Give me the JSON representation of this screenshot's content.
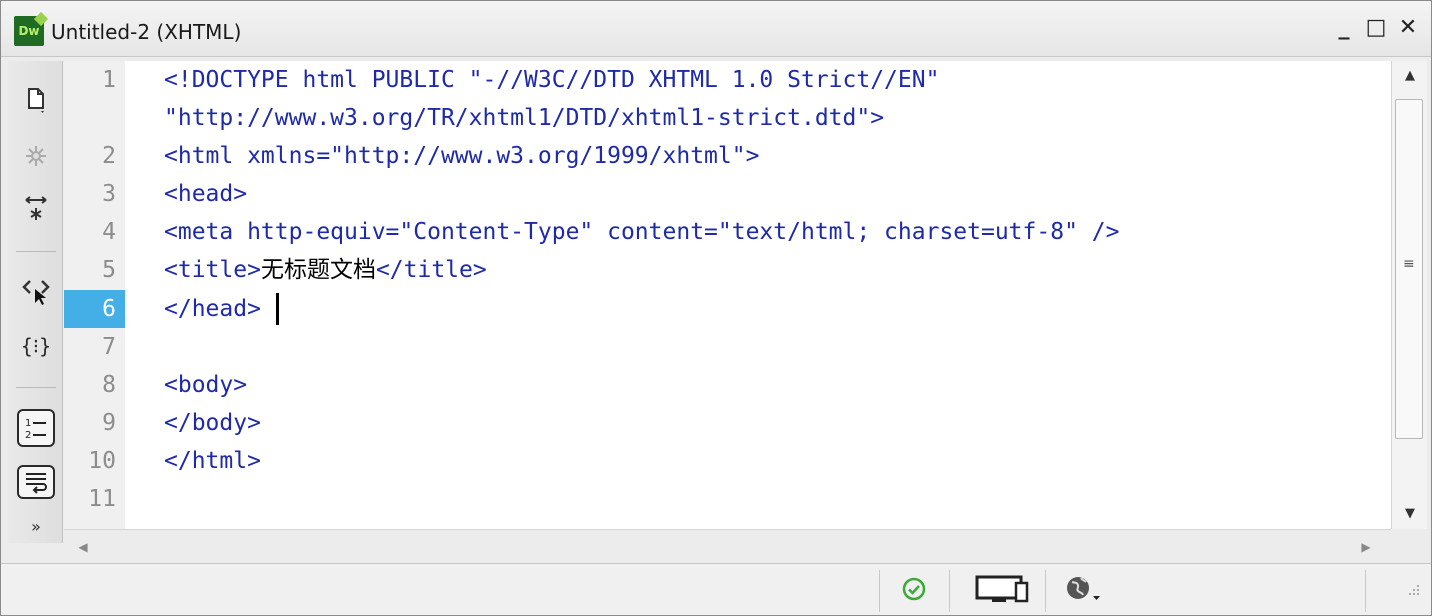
{
  "window": {
    "title": "Untitled-2 (XHTML)",
    "app_logo": "Dw",
    "controls": {
      "minimize": "_",
      "maximize": "□",
      "close": "✕"
    }
  },
  "toolbar": {
    "items": [
      {
        "icon": "open-documents-icon"
      },
      {
        "icon": "show-code-navigator-icon"
      },
      {
        "icon": "expand-selection-icon"
      },
      {
        "icon": "select-parent-tag-icon"
      },
      {
        "icon": "balance-braces-icon"
      },
      {
        "icon": "line-numbers-icon"
      },
      {
        "icon": "word-wrap-icon"
      },
      {
        "icon": "more-tools-icon"
      }
    ]
  },
  "editor": {
    "active_line": 6,
    "line_numbers": [
      "1",
      "",
      "2",
      "3",
      "4",
      "5",
      "6",
      "7",
      "8",
      "9",
      "10",
      "11"
    ],
    "lines": [
      "<!DOCTYPE html PUBLIC \"-//W3C//DTD XHTML 1.0 Strict//EN\"",
      "\"http://www.w3.org/TR/xhtml1/DTD/xhtml1-strict.dtd\">",
      "<html xmlns=\"http://www.w3.org/1999/xhtml\">",
      "<head>",
      "<meta http-equiv=\"Content-Type\" content=\"text/html; charset=utf-8\" />",
      "",
      "</head>",
      "",
      "<body>",
      "</body>",
      "</html>",
      ""
    ],
    "title_line": {
      "open": "<title>",
      "text": "无标题文档",
      "close": "</title>"
    }
  },
  "statusbar": {
    "validation_icon": "check-circle-icon",
    "device_icon": "desktop-tablet-icon",
    "preview_icon": "globe-icon"
  },
  "colors": {
    "code_text": "#1e2aa8",
    "line_highlight": "#44aee6",
    "gutter_text": "#8c8c8c",
    "valid_green": "#3aaa35"
  }
}
